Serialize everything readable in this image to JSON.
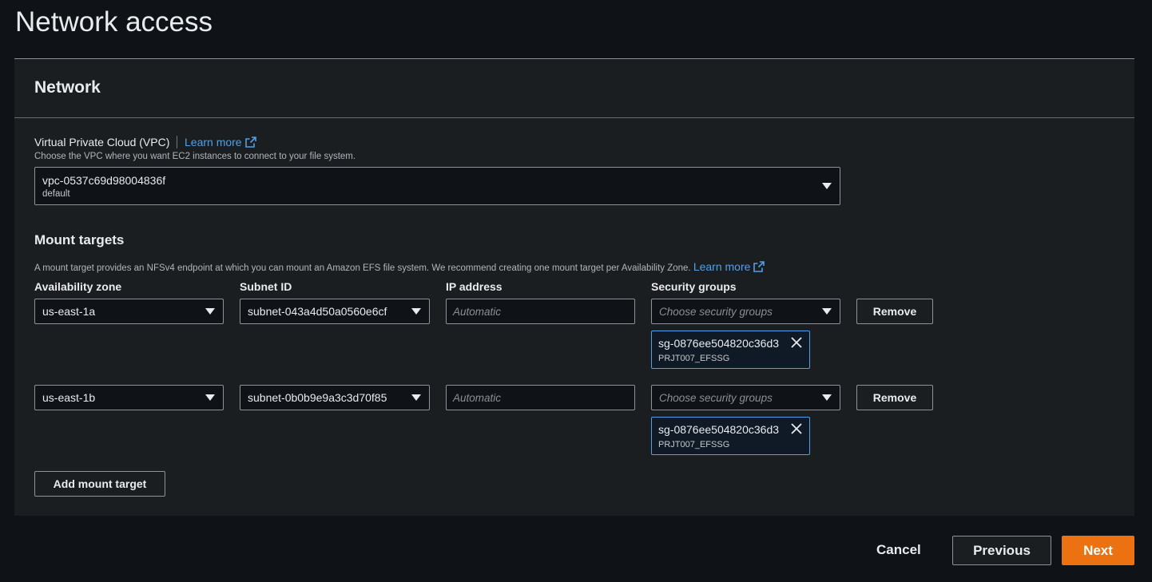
{
  "page": {
    "title": "Network access"
  },
  "panel": {
    "title": "Network"
  },
  "vpc": {
    "label": "Virtual Private Cloud (VPC)",
    "learn_more": "Learn more",
    "description": "Choose the VPC where you want EC2 instances to connect to your file system.",
    "selected_value": "vpc-0537c69d98004836f",
    "selected_sub": "default"
  },
  "mount_targets": {
    "title": "Mount targets",
    "description": "A mount target provides an NFSv4 endpoint at which you can mount an Amazon EFS file system. We recommend creating one mount target per Availability Zone.",
    "learn_more": "Learn more",
    "columns": {
      "availability_zone": "Availability zone",
      "subnet_id": "Subnet ID",
      "ip_address": "IP address",
      "security_groups": "Security groups"
    },
    "rows": [
      {
        "availability_zone": "us-east-1a",
        "subnet_id": "subnet-043a4d50a0560e6cf",
        "ip_placeholder": "Automatic",
        "sg_placeholder": "Choose security groups",
        "remove_label": "Remove",
        "security_group": {
          "id": "sg-0876ee504820c36d3",
          "name": "PRJT007_EFSSG"
        }
      },
      {
        "availability_zone": "us-east-1b",
        "subnet_id": "subnet-0b0b9e9a3c3d70f85",
        "ip_placeholder": "Automatic",
        "sg_placeholder": "Choose security groups",
        "remove_label": "Remove",
        "security_group": {
          "id": "sg-0876ee504820c36d3",
          "name": "PRJT007_EFSSG"
        }
      }
    ],
    "add_label": "Add mount target"
  },
  "footer": {
    "cancel_label": "Cancel",
    "previous_label": "Previous",
    "next_label": "Next"
  },
  "colors": {
    "background": "#0f1217",
    "panel": "#1b1e21",
    "link": "#539fe5",
    "primary": "#ec7211"
  },
  "icons": {
    "external_link": "external-link-icon",
    "caret": "caret-down-icon",
    "dismiss": "close-icon"
  }
}
